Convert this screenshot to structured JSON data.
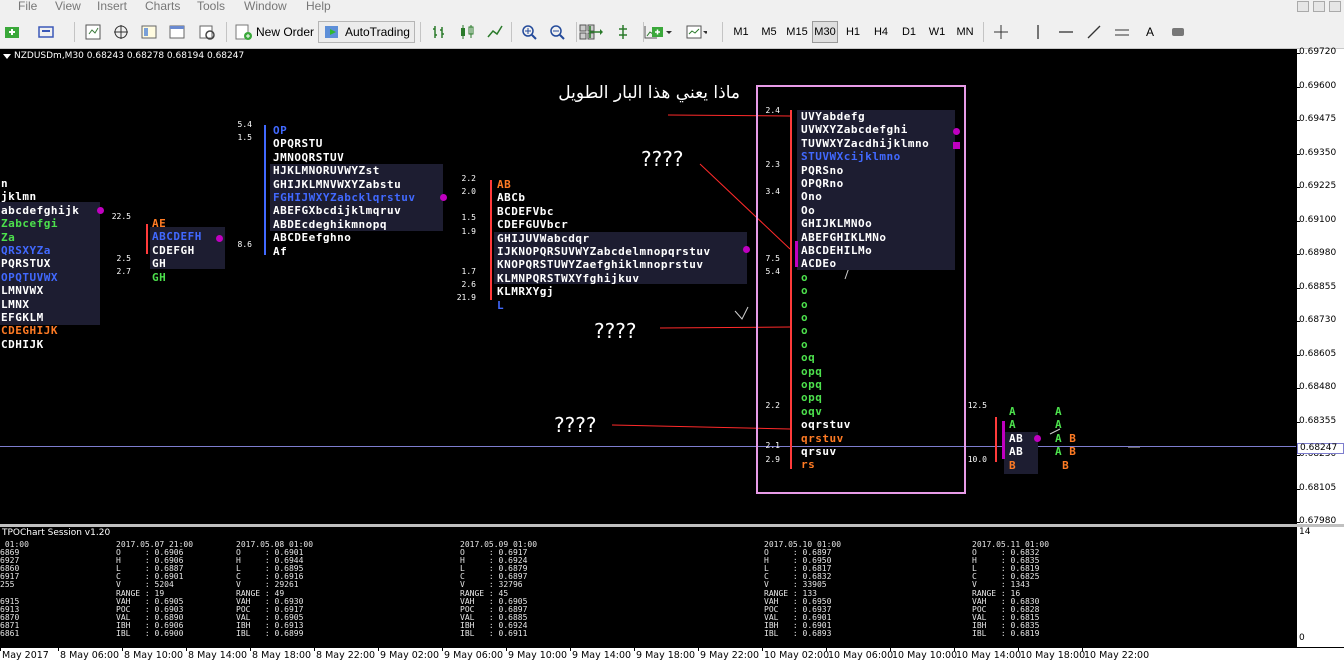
{
  "menu": [
    "File",
    "View",
    "Insert",
    "Charts",
    "Tools",
    "Window",
    "Help"
  ],
  "toolbar": {
    "new_order": "New Order",
    "autotrading": "AutoTrading",
    "timeframes": [
      "M1",
      "M5",
      "M15",
      "M30",
      "H1",
      "H4",
      "D1",
      "W1",
      "MN"
    ],
    "active_timeframe": "M30",
    "text_tool": "A"
  },
  "chart": {
    "info": "NZDUSDm,M30  0.68243 0.68278 0.68194 0.68247",
    "current_price": "0.68247",
    "annotations": {
      "arabic_question": "ماذا يعني هذا البار الطويل",
      "q1": "????",
      "q2": "????",
      "q3": "????"
    },
    "colors": {
      "blue": "#4169ff",
      "green": "#4ce04c",
      "orange": "#ff7b24",
      "red": "#ff3b3b",
      "white": "#ffffff",
      "magenta": "#c000c0",
      "selection_box": "#e79be7",
      "profile_bg": "#1d1d31"
    }
  },
  "price_axis": [
    "0.69720",
    "0.69600",
    "0.69475",
    "0.69350",
    "0.69225",
    "0.69100",
    "0.68980",
    "0.68855",
    "0.68730",
    "0.68605",
    "0.68480",
    "0.68355",
    "0.68230",
    "0.68105",
    "0.67980"
  ],
  "profiles": [
    {
      "values": [
        {
          "t": "22.5"
        },
        {
          "t": "2.5"
        },
        {
          "t": "2.7"
        }
      ],
      "rows": [
        [
          [
            "n",
            "w"
          ]
        ],
        [
          [
            "jklmn",
            "w"
          ]
        ],
        [
          [
            "abcdefghijk",
            "w"
          ]
        ],
        [
          [
            "Zabcefgi",
            "g"
          ]
        ],
        [
          [
            "Za",
            "g"
          ]
        ],
        [
          [
            "QRSXYZa",
            "b"
          ]
        ],
        [
          [
            "PQRSTUX",
            "w"
          ]
        ],
        [
          [
            "OPQTUVWX",
            "b"
          ]
        ],
        [
          [
            "LMNVWX",
            "w"
          ]
        ],
        [
          [
            "LMNX",
            "w"
          ]
        ],
        [
          [
            "EFGKLM",
            "w"
          ]
        ],
        [
          [
            "CDEGHIJK",
            "o"
          ]
        ],
        [
          [
            "CDHIJK",
            "w"
          ]
        ]
      ],
      "rows2": [
        [
          [
            "AE",
            "o"
          ]
        ],
        [
          [
            "ABCDEFH",
            "b"
          ]
        ],
        [
          [
            "CDEFGH",
            "w"
          ]
        ],
        [
          [
            "GH",
            "w"
          ]
        ],
        [
          [
            "GH",
            "g"
          ]
        ]
      ]
    },
    {
      "values": [
        {
          "t": "5.4"
        },
        {
          "t": "1.5"
        },
        {
          "t": "8.6"
        }
      ],
      "rows": [
        [
          [
            "OP",
            "b"
          ]
        ],
        [
          [
            "OPQRSTU",
            "w"
          ]
        ],
        [
          [
            "JMNOQRSTUV",
            "w"
          ]
        ],
        [
          [
            "HJKLMNORUVWYZst",
            "w"
          ]
        ],
        [
          [
            "GHIJKLMNVWXYZabstu",
            "w"
          ]
        ],
        [
          [
            "FGHIJWXYZabcklqrstuv",
            "b"
          ]
        ],
        [
          [
            "ABEFGXbcdijklmqruv",
            "w"
          ]
        ],
        [
          [
            "ABDEcdeghikmnopq",
            "w"
          ]
        ],
        [
          [
            "ABCDEefghno",
            "w"
          ]
        ],
        [
          [
            "Af",
            "w"
          ]
        ]
      ]
    },
    {
      "values": [
        {
          "t": "2.2"
        },
        {
          "t": "2.0"
        },
        {
          "t": "1.5"
        },
        {
          "t": "1.9"
        },
        {
          "t": "1.7"
        },
        {
          "t": "2.6"
        },
        {
          "t": "21.9"
        }
      ],
      "rows": [
        [
          [
            "AB",
            "o"
          ]
        ],
        [
          [
            "ABCb",
            "w"
          ]
        ],
        [
          [
            "BCDEFVbc",
            "w"
          ]
        ],
        [
          [
            "CDEFGUVbcr",
            "w"
          ]
        ],
        [
          [
            "GHIJUVWabcdqr",
            "w"
          ]
        ],
        [
          [
            "IJKNOPQRSUVWYZabcdelmnopqrstuv",
            "w"
          ]
        ],
        [
          [
            "KNOPQRSTUWYZaefghiklmnoprstuv",
            "w"
          ]
        ],
        [
          [
            "KLMNPQRSTWXYfghijkuv",
            "w"
          ]
        ],
        [
          [
            "KLMRXYgj",
            "w"
          ]
        ],
        [
          [
            "L",
            "b"
          ]
        ]
      ]
    },
    {
      "values": [
        {
          "t": "2.4"
        },
        {
          "t": "2.3"
        },
        {
          "t": "3.4"
        },
        {
          "t": "7.5"
        },
        {
          "t": "5.4"
        },
        {
          "t": "2.2"
        },
        {
          "t": "2.1"
        },
        {
          "t": "2.9"
        }
      ],
      "rows": [
        [
          [
            "UVYabdefg",
            "w"
          ]
        ],
        [
          [
            "UVWXYZabcdefghi",
            "w"
          ]
        ],
        [
          [
            "TUVWXYZacdhijklmno",
            "w"
          ]
        ],
        [
          [
            "STUVWXcijklmno",
            "b"
          ]
        ],
        [
          [
            "PQRSno",
            "w"
          ]
        ],
        [
          [
            "OPQRno",
            "w"
          ]
        ],
        [
          [
            "Ono",
            "w"
          ]
        ],
        [
          [
            "Oo",
            "w"
          ]
        ],
        [
          [
            "GHIJKLMNOo",
            "w"
          ]
        ],
        [
          [
            "ABEFGHIKLMNo",
            "w"
          ]
        ],
        [
          [
            "ABCDEHILMo",
            "w"
          ]
        ],
        [
          [
            "ACDEo",
            "w"
          ]
        ],
        [
          [
            "o",
            "g"
          ]
        ],
        [
          [
            "o",
            "g"
          ]
        ],
        [
          [
            "o",
            "g"
          ]
        ],
        [
          [
            "o",
            "g"
          ]
        ],
        [
          [
            "o",
            "g"
          ]
        ],
        [
          [
            "o",
            "g"
          ]
        ],
        [
          [
            "oq",
            "g"
          ]
        ],
        [
          [
            "opq",
            "g"
          ]
        ],
        [
          [
            "opq",
            "g"
          ]
        ],
        [
          [
            "opq",
            "g"
          ]
        ],
        [
          [
            "oqv",
            "g"
          ]
        ],
        [
          [
            "oqrstuv",
            "w"
          ]
        ],
        [
          [
            "qrstuv",
            "o"
          ]
        ],
        [
          [
            "qrsuv",
            "w"
          ]
        ],
        [
          [
            "rs",
            "o"
          ]
        ]
      ]
    },
    {
      "values": [
        {
          "t": "12.5"
        },
        {
          "t": "10.0"
        }
      ],
      "rows": [
        [
          [
            "A",
            "g"
          ]
        ],
        [
          [
            "A",
            "g"
          ]
        ],
        [
          [
            "AB",
            "w"
          ]
        ],
        [
          [
            "AB",
            "w"
          ]
        ],
        [
          [
            "B",
            "o"
          ]
        ]
      ],
      "rows2": [
        [
          [
            "A",
            "g"
          ]
        ],
        [
          [
            "A",
            "g"
          ]
        ],
        [
          [
            "A",
            "g"
          ],
          [
            " B",
            "o"
          ]
        ],
        [
          [
            "A",
            "g"
          ],
          [
            " B",
            "o"
          ]
        ],
        [
          [
            " B",
            "o"
          ]
        ]
      ]
    }
  ],
  "sub_window": {
    "title": "TPOChart Session v1.20",
    "axis_top": "14",
    "axis_bottom": "0",
    "sessions": [
      {
        "text": " 01:00\n6869\n6927\n6860\n6917\n255\n\n6915\n6913\n6870\n6871\n6861"
      },
      {
        "text": "2017.05.07 21:00\nO     : 0.6906\nH     : 0.6906\nL     : 0.6887\nC     : 0.6901\nV     : 5204\nRANGE : 19\nVAH   : 0.6905\nPOC   : 0.6903\nVAL   : 0.6890\nIBH   : 0.6906\nIBL   : 0.6900"
      },
      {
        "text": "2017.05.08 01:00\nO     : 0.6901\nH     : 0.6944\nL     : 0.6895\nC     : 0.6916\nV     : 29261\nRANGE : 49\nVAH   : 0.6930\nPOC   : 0.6917\nVAL   : 0.6905\nIBH   : 0.6913\nIBL   : 0.6899"
      },
      {
        "text": "2017.05.09 01:00\nO     : 0.6917\nH     : 0.6924\nL     : 0.6879\nC     : 0.6897\nV     : 32796\nRANGE : 45\nVAH   : 0.6905\nPOC   : 0.6897\nVAL   : 0.6885\nIBH   : 0.6924\nIBL   : 0.6911"
      },
      {
        "text": "2017.05.10 01:00\nO     : 0.6897\nH     : 0.6950\nL     : 0.6817\nC     : 0.6832\nV     : 33905\nRANGE : 133\nVAH   : 0.6950\nPOC   : 0.6937\nVAL   : 0.6901\nIBH   : 0.6901\nIBL   : 0.6893"
      },
      {
        "text": "2017.05.11 01:00\nO     : 0.6832\nH     : 0.6835\nL     : 0.6819\nC     : 0.6825\nV     : 1343\nRANGE : 16\nVAH   : 0.6830\nPOC   : 0.6828\nVAL   : 0.6815\nIBH   : 0.6835\nIBL   : 0.6819"
      }
    ]
  },
  "time_axis": [
    "May 2017",
    "8 May 06:00",
    "8 May 10:00",
    "8 May 14:00",
    "8 May 18:00",
    "8 May 22:00",
    "9 May 02:00",
    "9 May 06:00",
    "9 May 10:00",
    "9 May 14:00",
    "9 May 18:00",
    "9 May 22:00",
    "10 May 02:00",
    "10 May 06:00",
    "10 May 10:00",
    "10 May 14:00",
    "10 May 18:00",
    "10 May 22:00"
  ]
}
